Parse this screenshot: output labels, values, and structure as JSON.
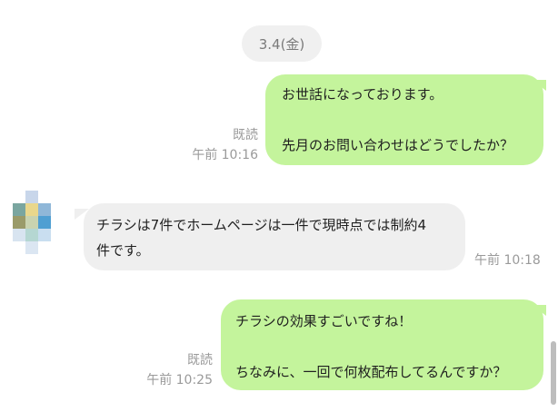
{
  "date_separator": "3.4(金)",
  "messages": [
    {
      "side": "me",
      "text": "お世話になっております。\n\n先月のお問い合わせはどうでしたか？",
      "read": "既読",
      "time": "午前 10:16"
    },
    {
      "side": "them",
      "text": "チラシは7件でホームページは一件で現時点では制約4\n件です。",
      "time": "午前 10:18"
    },
    {
      "side": "me",
      "text": "チラシの効果すごいですね！\n\nちなみに、一回で何枚配布してるんですか？",
      "read": "既読",
      "time": "午前 10:25"
    }
  ],
  "colors": {
    "my_bubble": "#c4f49c",
    "their_bubble": "#efefef",
    "meta_text": "#9a9a9a",
    "date_pill": "#f0f0f0"
  },
  "avatar": {
    "icon": "blurred-profile-avatar"
  }
}
